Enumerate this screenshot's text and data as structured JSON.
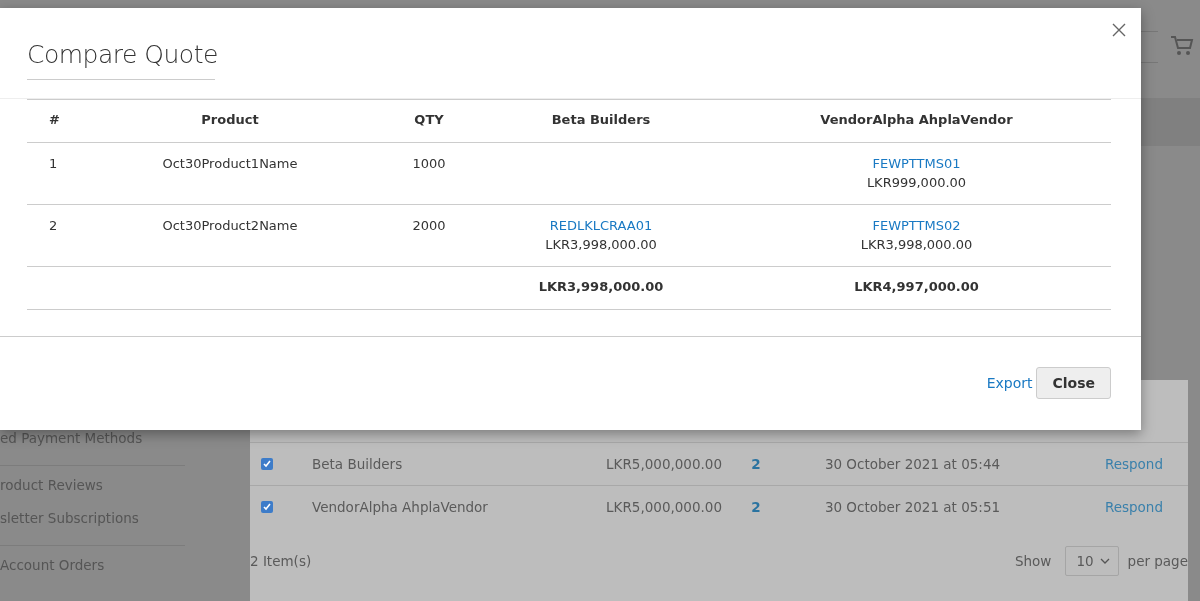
{
  "background": {
    "sidebar_items": [
      "ed Payment Methods",
      "roduct Reviews",
      "sletter Subscriptions",
      "Account Orders"
    ],
    "quotes_table": {
      "rows": [
        {
          "checked": true,
          "vendor": "Beta Builders",
          "amount": "LKR5,000,000.00",
          "items": "2",
          "date": "30 October 2021 at 05:44",
          "action": "Respond"
        },
        {
          "checked": true,
          "vendor": "VendorAlpha AhplaVendor",
          "amount": "LKR5,000,000.00",
          "items": "2",
          "date": "30 October 2021 at 05:51",
          "action": "Respond"
        }
      ]
    },
    "item_count": "2 Item(s)",
    "show_label": "Show",
    "per_page": "10",
    "per_page_label": "per page"
  },
  "modal": {
    "title": "Compare Quote",
    "columns": [
      "#",
      "Product",
      "QTY",
      "Beta Builders",
      "VendorAlpha AhplaVendor"
    ],
    "rows": [
      {
        "number": "1",
        "product": "Oct30Product1Name",
        "qty": "1000",
        "quotes": {
          "vendor_2": {
            "code": "FEWPTTMS01",
            "price": "LKR999,000.00"
          }
        }
      },
      {
        "number": "2",
        "product": "Oct30Product2Name",
        "qty": "2000",
        "quotes": {
          "vendor_1": {
            "code": "REDLKLCRAA01",
            "price": "LKR3,998,000.00"
          },
          "vendor_2": {
            "code": "FEWPTTMS02",
            "price": "LKR3,998,000.00"
          }
        }
      }
    ],
    "totals": [
      "LKR3,998,000.00",
      "LKR4,997,000.00"
    ],
    "export_link": "Export",
    "close_button": "Close"
  }
}
